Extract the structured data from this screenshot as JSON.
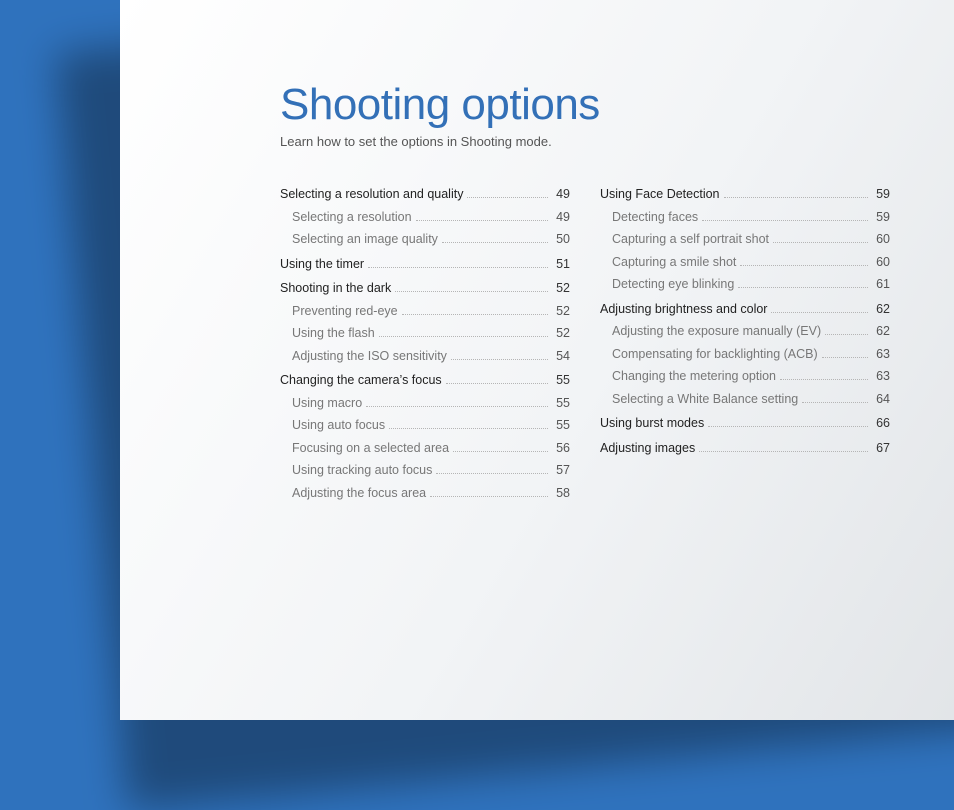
{
  "title": "Shooting options",
  "subtitle": "Learn how to set the options in Shooting mode.",
  "columns": [
    [
      {
        "title": "Selecting a resolution and quality",
        "page": "49",
        "items": [
          {
            "label": "Selecting a resolution",
            "page": "49"
          },
          {
            "label": "Selecting an image quality",
            "page": "50"
          }
        ]
      },
      {
        "title": "Using the timer",
        "page": "51",
        "items": []
      },
      {
        "title": "Shooting in the dark",
        "page": "52",
        "items": [
          {
            "label": "Preventing red-eye",
            "page": "52"
          },
          {
            "label": "Using the flash",
            "page": "52"
          },
          {
            "label": "Adjusting the ISO sensitivity",
            "page": "54"
          }
        ]
      },
      {
        "title": "Changing the camera’s focus",
        "page": "55",
        "items": [
          {
            "label": "Using macro",
            "page": "55"
          },
          {
            "label": "Using auto focus",
            "page": "55"
          },
          {
            "label": "Focusing on a selected area",
            "page": "56"
          },
          {
            "label": "Using tracking auto focus",
            "page": "57"
          },
          {
            "label": "Adjusting the focus area",
            "page": "58"
          }
        ]
      }
    ],
    [
      {
        "title": "Using Face Detection",
        "page": "59",
        "items": [
          {
            "label": "Detecting faces",
            "page": "59"
          },
          {
            "label": "Capturing a self portrait shot",
            "page": "60"
          },
          {
            "label": "Capturing a smile shot",
            "page": "60"
          },
          {
            "label": "Detecting eye blinking",
            "page": "61"
          }
        ]
      },
      {
        "title": "Adjusting brightness and color",
        "page": "62",
        "items": [
          {
            "label": "Adjusting the exposure manually (EV)",
            "page": "62"
          },
          {
            "label": "Compensating for backlighting (ACB)",
            "page": "63"
          },
          {
            "label": "Changing the metering option",
            "page": "63"
          },
          {
            "label": "Selecting a White Balance setting",
            "page": "64"
          }
        ]
      },
      {
        "title": "Using burst modes",
        "page": "66",
        "items": []
      },
      {
        "title": "Adjusting images",
        "page": "67",
        "items": []
      }
    ]
  ]
}
